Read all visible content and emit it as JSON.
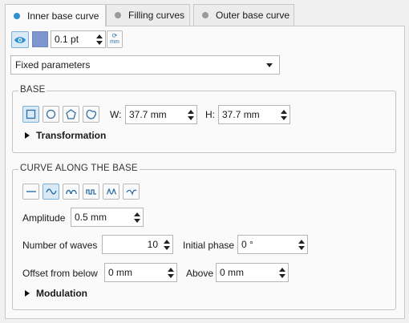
{
  "tabs": [
    {
      "label": "Inner base curve",
      "active": true
    },
    {
      "label": "Filling curves",
      "active": false
    },
    {
      "label": "Outer base curve",
      "active": false
    }
  ],
  "toolbar": {
    "line_width": "0.1 pt",
    "swatch_color": "#7f95cf",
    "unit_toggle": "mm"
  },
  "mode_select": {
    "value": "Fixed parameters"
  },
  "base": {
    "title": "BASE",
    "shapes": [
      "square-icon",
      "circle-icon",
      "pentagon-icon",
      "blob-icon"
    ],
    "w_label": "W:",
    "w_value": "37.7 mm",
    "h_label": "H:",
    "h_value": "37.7 mm",
    "transformation": "Transformation"
  },
  "curve": {
    "title": "CURVE ALONG THE BASE",
    "wave_types": [
      "flat-wave-icon",
      "sine-wave-icon",
      "arch-wave-icon",
      "square-wave-icon",
      "peak-wave-icon",
      "dip-wave-icon"
    ],
    "amplitude_label": "Amplitude",
    "amplitude_value": "0.5 mm",
    "waves_label": "Number of waves",
    "waves_value": "10",
    "phase_label": "Initial phase",
    "phase_value": "0 °",
    "offset_label": "Offset  from below",
    "offset_value": "0 mm",
    "above_label": "Above",
    "above_value": "0 mm",
    "modulation": "Modulation"
  },
  "colors": {
    "accent": "#2d8fce",
    "selected_bg": "#d9e9f6"
  }
}
